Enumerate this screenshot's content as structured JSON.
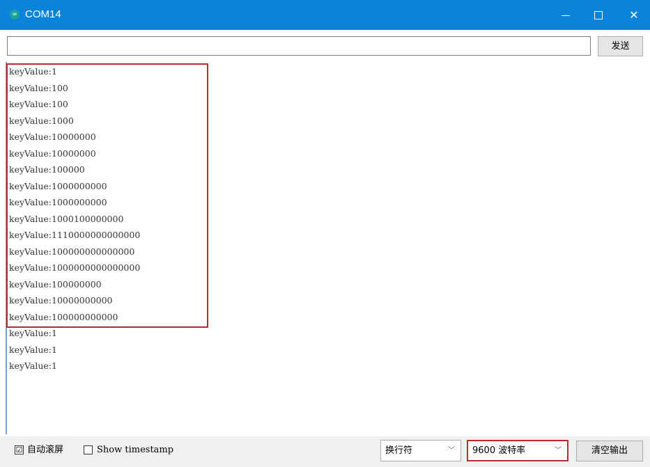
{
  "window": {
    "title": "COM14",
    "icon": "arduino-infinity-icon",
    "minimize_glyph": "—",
    "maximize_glyph": "☐",
    "close_glyph": "✕"
  },
  "send_bar": {
    "input_value": "",
    "send_label": "发送"
  },
  "output": {
    "lines": [
      "keyValue:1",
      "keyValue:100",
      "keyValue:100",
      "keyValue:1000",
      "keyValue:10000000",
      "keyValue:10000000",
      "keyValue:100000",
      "keyValue:1000000000",
      "keyValue:1000000000",
      "keyValue:1000100000000",
      "keyValue:1110000000000000",
      "keyValue:100000000000000",
      "keyValue:1000000000000000",
      "keyValue:100000000",
      "keyValue:10000000000",
      "keyValue:100000000000",
      "keyValue:1",
      "keyValue:1",
      "keyValue:1"
    ]
  },
  "status_bar": {
    "autoscroll_label": "自动滚屏",
    "autoscroll_checked": "☑",
    "timestamp_label": "Show timestamp",
    "line_ending_value": "换行符",
    "baud_value": "9600 波特率",
    "dropdown_glyph": "﹀",
    "clear_label": "清空输出"
  },
  "colors": {
    "titlebar": "#0a84d8",
    "highlight": "#c0282d"
  }
}
